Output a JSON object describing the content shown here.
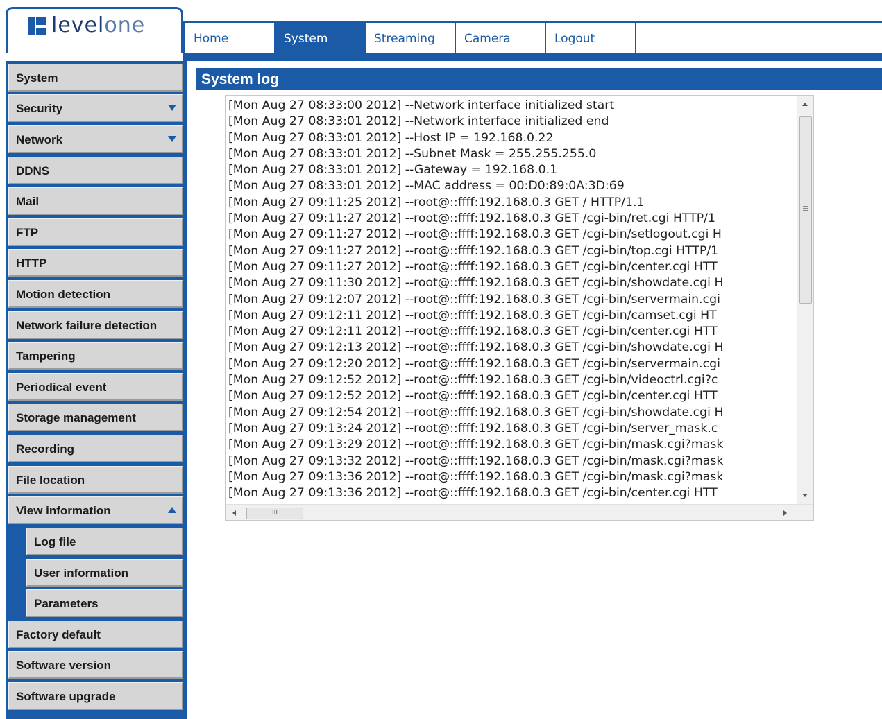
{
  "brand": {
    "name_bold": "level",
    "name_light": "one"
  },
  "nav": {
    "tabs": [
      {
        "label": "Home",
        "active": false
      },
      {
        "label": "System",
        "active": true
      },
      {
        "label": "Streaming",
        "active": false
      },
      {
        "label": "Camera",
        "active": false
      },
      {
        "label": "Logout",
        "active": false
      }
    ]
  },
  "sidebar": {
    "items": [
      {
        "label": "System"
      },
      {
        "label": "Security",
        "arrow": "down"
      },
      {
        "label": "Network",
        "arrow": "down"
      },
      {
        "label": "DDNS"
      },
      {
        "label": "Mail"
      },
      {
        "label": "FTP"
      },
      {
        "label": "HTTP"
      },
      {
        "label": "Motion detection"
      },
      {
        "label": "Network failure detection"
      },
      {
        "label": "Tampering"
      },
      {
        "label": "Periodical event"
      },
      {
        "label": "Storage management"
      },
      {
        "label": "Recording"
      },
      {
        "label": "File location"
      },
      {
        "label": "View information",
        "arrow": "up"
      },
      {
        "label": "Log file",
        "sub": true
      },
      {
        "label": "User information",
        "sub": true
      },
      {
        "label": "Parameters",
        "sub": true
      },
      {
        "label": "Factory default"
      },
      {
        "label": "Software version"
      },
      {
        "label": "Software upgrade"
      }
    ]
  },
  "main": {
    "title": "System log",
    "log": [
      "[Mon Aug 27 08:33:00 2012] --Network interface initialized start",
      "[Mon Aug 27 08:33:01 2012] --Network interface initialized end",
      "[Mon Aug 27 08:33:01 2012] --Host IP = 192.168.0.22",
      "[Mon Aug 27 08:33:01 2012] --Subnet Mask = 255.255.255.0",
      "[Mon Aug 27 08:33:01 2012] --Gateway = 192.168.0.1",
      "[Mon Aug 27 08:33:01 2012] --MAC address = 00:D0:89:0A:3D:69",
      "[Mon Aug 27 09:11:25 2012] --root@::ffff:192.168.0.3 GET / HTTP/1.1",
      "[Mon Aug 27 09:11:27 2012] --root@::ffff:192.168.0.3 GET /cgi-bin/ret.cgi HTTP/1",
      "[Mon Aug 27 09:11:27 2012] --root@::ffff:192.168.0.3 GET /cgi-bin/setlogout.cgi H",
      "[Mon Aug 27 09:11:27 2012] --root@::ffff:192.168.0.3 GET /cgi-bin/top.cgi HTTP/1",
      "[Mon Aug 27 09:11:27 2012] --root@::ffff:192.168.0.3 GET /cgi-bin/center.cgi HTT",
      "[Mon Aug 27 09:11:30 2012] --root@::ffff:192.168.0.3 GET /cgi-bin/showdate.cgi H",
      "[Mon Aug 27 09:12:07 2012] --root@::ffff:192.168.0.3 GET /cgi-bin/servermain.cgi",
      "[Mon Aug 27 09:12:11 2012] --root@::ffff:192.168.0.3 GET /cgi-bin/camset.cgi HT",
      "[Mon Aug 27 09:12:11 2012] --root@::ffff:192.168.0.3 GET /cgi-bin/center.cgi HTT",
      "[Mon Aug 27 09:12:13 2012] --root@::ffff:192.168.0.3 GET /cgi-bin/showdate.cgi H",
      "[Mon Aug 27 09:12:20 2012] --root@::ffff:192.168.0.3 GET /cgi-bin/servermain.cgi",
      "[Mon Aug 27 09:12:52 2012] --root@::ffff:192.168.0.3 GET /cgi-bin/videoctrl.cgi?c",
      "[Mon Aug 27 09:12:52 2012] --root@::ffff:192.168.0.3 GET /cgi-bin/center.cgi HTT",
      "[Mon Aug 27 09:12:54 2012] --root@::ffff:192.168.0.3 GET /cgi-bin/showdate.cgi H",
      "[Mon Aug 27 09:13:24 2012] --root@::ffff:192.168.0.3 GET /cgi-bin/server_mask.c",
      "[Mon Aug 27 09:13:29 2012] --root@::ffff:192.168.0.3 GET /cgi-bin/mask.cgi?mask",
      "[Mon Aug 27 09:13:32 2012] --root@::ffff:192.168.0.3 GET /cgi-bin/mask.cgi?mask",
      "[Mon Aug 27 09:13:36 2012] --root@::ffff:192.168.0.3 GET /cgi-bin/mask.cgi?mask",
      "[Mon Aug 27 09:13:36 2012] --root@::ffff:192.168.0.3 GET /cgi-bin/center.cgi HTT"
    ],
    "hscroll_grip": "III"
  },
  "colors": {
    "brand_blue": "#1a5aa6",
    "sidebar_gray": "#d6d6d6"
  }
}
